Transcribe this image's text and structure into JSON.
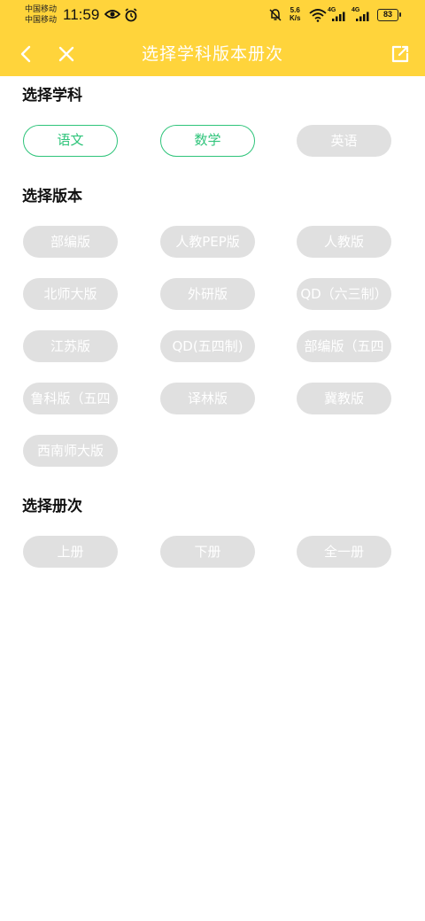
{
  "status_bar": {
    "carrier_1": "中国移动",
    "carrier_2": "中国移动",
    "time": "11:59",
    "speed_value": "5.6",
    "speed_unit": "K/s",
    "battery": "83",
    "network_1": "4G",
    "network_2": "4G"
  },
  "header": {
    "title": "选择学科版本册次",
    "back_icon": "chevron-left-icon",
    "close_icon": "close-icon",
    "share_icon": "share-icon"
  },
  "colors": {
    "header_bg": "#FFD43B",
    "selected": "#2EC47A",
    "chip_bg": "#E0E0E0"
  },
  "subject": {
    "title": "选择学科",
    "options": [
      {
        "label": "语文",
        "selected": true
      },
      {
        "label": "数学",
        "selected": true
      },
      {
        "label": "英语",
        "selected": false
      }
    ]
  },
  "edition": {
    "title": "选择版本",
    "options": [
      {
        "label": "部编版"
      },
      {
        "label": "人教PEP版"
      },
      {
        "label": "人教版"
      },
      {
        "label": "北师大版"
      },
      {
        "label": "外研版"
      },
      {
        "label": "QD（六三制）"
      },
      {
        "label": "江苏版"
      },
      {
        "label": "QD(五四制)"
      },
      {
        "label": "部编版（五四"
      },
      {
        "label": "鲁科版（五四"
      },
      {
        "label": "译林版"
      },
      {
        "label": "冀教版"
      },
      {
        "label": "西南师大版"
      }
    ]
  },
  "volume": {
    "title": "选择册次",
    "options": [
      {
        "label": "上册"
      },
      {
        "label": "下册"
      },
      {
        "label": "全一册"
      }
    ]
  }
}
